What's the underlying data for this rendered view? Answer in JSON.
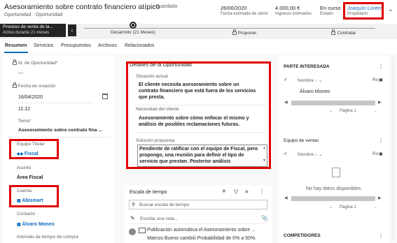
{
  "header": {
    "title": "Asesoramiento sobre contrato financiero atípico",
    "saved": "- Guardado",
    "subtitle": "Oportunidad · Oportunidad",
    "fields": [
      {
        "value": "26/06/2020",
        "label": "Fecha estimada de cierre"
      },
      {
        "value": "4.000,00 €",
        "label": "Ingresos estimados"
      },
      {
        "value": "En curso",
        "label": "Estado"
      },
      {
        "value": "Joaquín Lorem",
        "label": "Propietario"
      }
    ]
  },
  "process": {
    "active_name": "Proceso de venta de la...",
    "active_duration": "Activo durante 21 meses",
    "stages": [
      "Desarrollo  (21 Meses)",
      "Proponer",
      "Contratar"
    ]
  },
  "tabs": [
    "Resumen",
    "Servicios",
    "Presupuestos",
    "Archivos",
    "Relacionados"
  ],
  "left": {
    "id_label": "Id. de Oportunidad*",
    "id_value": "---",
    "created_label": "Fecha de creación",
    "created_date": "16/04/2020",
    "created_time": "11:12",
    "topic_label": "Tema*",
    "topic_value": "Asesoramiento sobre contrato fina ...",
    "team_label": "Equipo Titular",
    "team_value": "Fiscal",
    "subject_label": "Asunto",
    "subject_value": "Área Fiscal",
    "account_label": "Cuenta",
    "account_value": "Abismart",
    "contact_label": "Contacto",
    "contact_value": "Álvaro Moneo",
    "interval_label": "Intervalo de tiempo de compra"
  },
  "details": {
    "title": "Detalles de la Oportunidad",
    "situation_label": "Situación actual",
    "situation_text": "El cliente necesita asesoramiento sobre un contrato financiero que está fuera de los servicios que presta.",
    "need_label": "Necesidad del cliente",
    "need_text": "Asesoramiento sobre cómo enfocar el mismo y análisis de posibles reclamaciones futuras.",
    "proposal_label": "Solución propuesta",
    "proposal_text": "Pendiente de ratificar con el equipo de Fiscal, pero propongo, una reunión para definir el tipo de servicio que prestan. Posterior análisis"
  },
  "timeline": {
    "title": "Escala de tiempo",
    "search_placeholder": "Buscar escala de tiempo",
    "note_placeholder": "Escriba una nota...",
    "post_text": "Publicación automática el Asesoramiento sobre ...",
    "post_sub": "Marcos Bueno cambió Probabilidad de 0% a 50%."
  },
  "right": {
    "stakeholders_title": "PARTE INTERESADA",
    "col_name": "Nombre",
    "col_role": "Ro",
    "stakeholder": "Álvaro Moneo",
    "page": "Página 1",
    "sales_team_title": "Equipo de ventas",
    "no_data": "No hay datos disponibles.",
    "competitors_title": "COMPETIDORES"
  },
  "colors": {
    "accent": "#0f6cbd",
    "highlight": "#e00000",
    "stage_dark": "#242424"
  }
}
